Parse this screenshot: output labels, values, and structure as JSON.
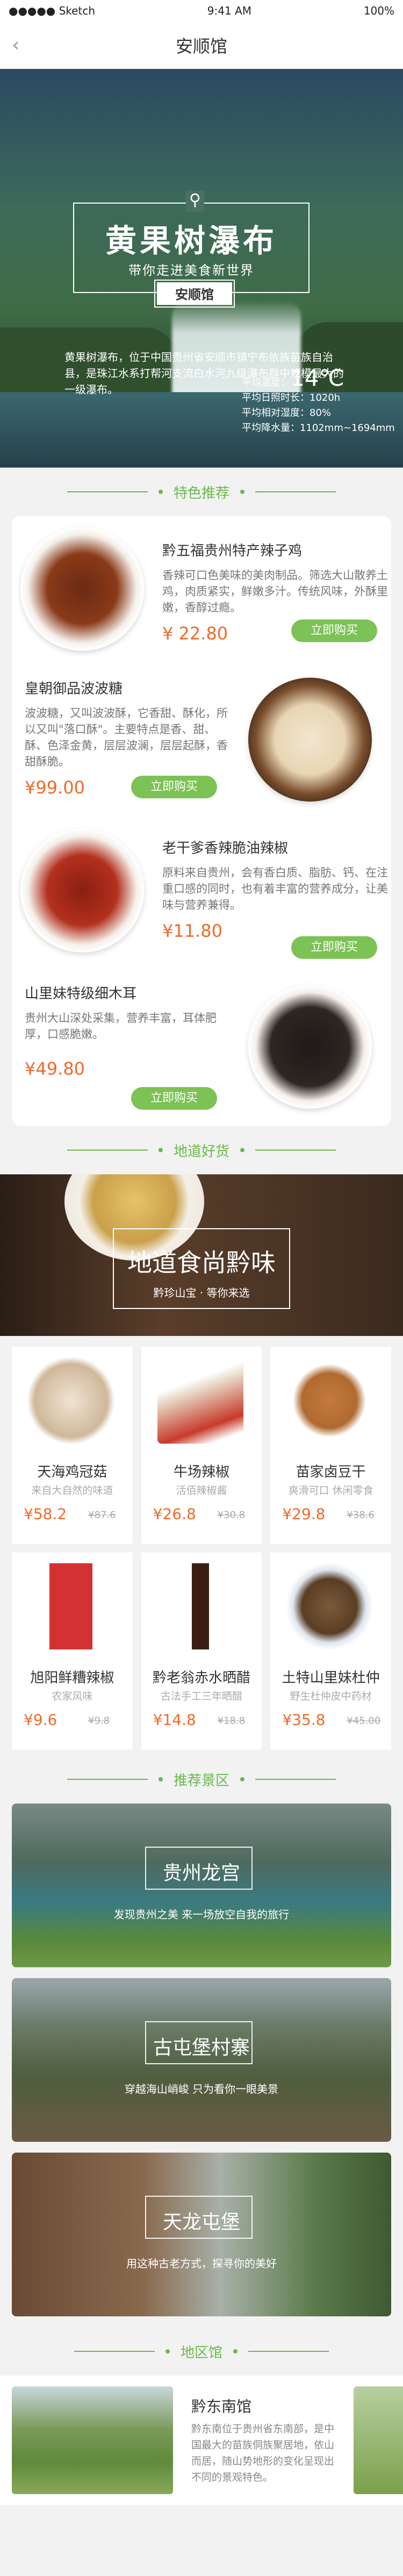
{
  "status": {
    "carrier": "●●●●● Sketch",
    "time": "9:41 AM",
    "battery": "100%"
  },
  "nav": {
    "back": "‹",
    "title": "安顺馆"
  },
  "hero": {
    "title": "黄果树瀑布",
    "subtitle": "带你走进美食新世界",
    "tag": "安顺馆",
    "desc": "黄果树瀑布，位于中国贵州省安顺市镇宁布依族苗族自治县，是珠江水系打帮河支流白水河九级瀑布群中规模最大的一级瀑布。",
    "temp_label": "平均温度：",
    "temp_value": "14℃",
    "stat1": "平均日照时长：1020h",
    "stat2": "平均相对湿度：80%",
    "stat3": "平均降水量：1102mm~1694mm"
  },
  "sections": {
    "recommend": "特色推荐",
    "local_goods": "地道好货",
    "scenic": "推荐景区",
    "region": "地区馆"
  },
  "products": [
    {
      "name": "黔五福贵州特产辣子鸡",
      "desc": "香辣可口色美味的美肉制品。筛选大山散养土鸡，肉质紧实，鲜嫩多汁。传统风味，外酥里嫩，香醇过瘾。",
      "price": "¥ 22.80",
      "btn": "立即购买"
    },
    {
      "name": "皇朝御品波波糖",
      "desc": "波波糖，又叫波波酥，它香甜、酥化，所以又叫\"落口酥\"。主要特点是香、甜、酥、色泽金黄，层层波澜，层层起酥，香甜酥脆。",
      "price": "¥99.00",
      "btn": "立即购买"
    },
    {
      "name": "老干爹香辣脆油辣椒",
      "desc": "原料来自贵州，会有香白质、脂肪、钙、在注重口感的同时，也有着丰富的营养成分，让美味与营养兼得。",
      "price": "¥11.80",
      "btn": "立即购买"
    },
    {
      "name": "山里妹特级细木耳",
      "desc": "贵州大山深处采集，营养丰富，耳体肥厚，口感脆嫩。",
      "price": "¥49.80",
      "btn": "立即购买"
    }
  ],
  "banner2": {
    "title": "地道食尚黔味",
    "sub": "黔珍山宝 · 等你来选"
  },
  "goods": [
    {
      "name": "天海鸡冠菇",
      "sub": "来自大自然的味道",
      "price": "¥58.2",
      "old": "¥87.6",
      "color": "#d9c7b1"
    },
    {
      "name": "牛场辣椒",
      "sub": "活佰辣椒酱",
      "price": "¥26.8",
      "old": "¥30.8",
      "color": "#c73a2a"
    },
    {
      "name": "苗家卤豆干",
      "sub": "爽滑可口 休闲零食",
      "price": "¥29.8",
      "old": "¥38.6",
      "color": "#c57a3e"
    },
    {
      "name": "旭阳鲜糟辣椒",
      "sub": "农家风味",
      "price": "¥9.6",
      "old": "¥9.8",
      "color": "#d43232"
    },
    {
      "name": "黔老翁赤水晒醋",
      "sub": "古法手工三年晒醋",
      "price": "¥14.8",
      "old": "¥18.8",
      "color": "#3a1e14"
    },
    {
      "name": "土特山里妹杜仲",
      "sub": "野生杜仲皮中药材",
      "price": "¥35.8",
      "old": "¥45.00",
      "color": "#7a5a3a"
    }
  ],
  "scenic": [
    {
      "name": "贵州龙宫",
      "desc": "发现贵州之美  来一场放空自我的旅行"
    },
    {
      "name": "古屯堡村寨",
      "desc": "穿越海山峭峻  只为看你一眼美景"
    },
    {
      "name": "天龙屯堡",
      "desc": "用这种古老方式，探寻你的美好"
    }
  ],
  "region": {
    "name": "黔东南馆",
    "desc": "黔东南位于贵州省东南部，是中国最大的苗族侗族聚居地，依山而居，随山势地形的变化呈现出不同的景观特色。"
  },
  "colors": {
    "accent": "#6bb84c",
    "price": "#f06a2a",
    "button": "#7cc255"
  }
}
